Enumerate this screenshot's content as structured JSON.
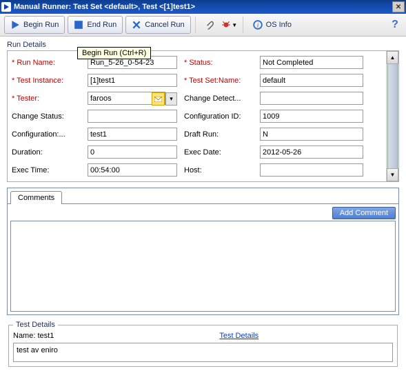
{
  "window": {
    "title": "Manual Runner: Test Set <default>, Test <[1]test1>"
  },
  "tooltip": "Begin Run (Ctrl+R)",
  "toolbar": {
    "begin": "Begin Run",
    "end": "End Run",
    "cancel": "Cancel Run",
    "osinfo": "OS Info"
  },
  "section": {
    "runDetails": "Run Details",
    "comments": "Comments",
    "addComment": "Add Comment",
    "testDetails": "Test Details",
    "testDetailsLink": "Test Details"
  },
  "fieldsLeft": [
    {
      "label": "* Run Name:",
      "value": "Run_5-26_0-54-23",
      "required": true,
      "dd": false
    },
    {
      "label": "* Test Instance:",
      "value": "[1]test1",
      "required": true,
      "dd": false
    },
    {
      "label": "* Tester:",
      "value": "faroos",
      "required": true,
      "dd": true
    },
    {
      "label": "Change Status:",
      "value": "",
      "required": false,
      "dd": false
    },
    {
      "label": "Configuration:...",
      "value": "test1",
      "required": false,
      "dd": false
    },
    {
      "label": "Duration:",
      "value": "0",
      "required": false,
      "dd": false
    },
    {
      "label": "Exec Time:",
      "value": "00:54:00",
      "required": false,
      "dd": false
    }
  ],
  "fieldsRight": [
    {
      "label": "* Status:",
      "value": "Not Completed",
      "required": true,
      "dd": false
    },
    {
      "label": "* Test Set:Name:",
      "value": "default",
      "required": true,
      "dd": false
    },
    {
      "label": "Change Detect...",
      "value": "",
      "required": false,
      "dd": false
    },
    {
      "label": "Configuration ID:",
      "value": "1009",
      "required": false,
      "dd": false
    },
    {
      "label": "Draft Run:",
      "value": "N",
      "required": false,
      "dd": false
    },
    {
      "label": "Exec Date:",
      "value": "2012-05-26",
      "required": false,
      "dd": false
    },
    {
      "label": "Host:",
      "value": "",
      "required": false,
      "dd": false
    }
  ],
  "testDetail": {
    "nameLabel": "Name:",
    "nameValue": "test1",
    "desc": "test av eniro"
  }
}
